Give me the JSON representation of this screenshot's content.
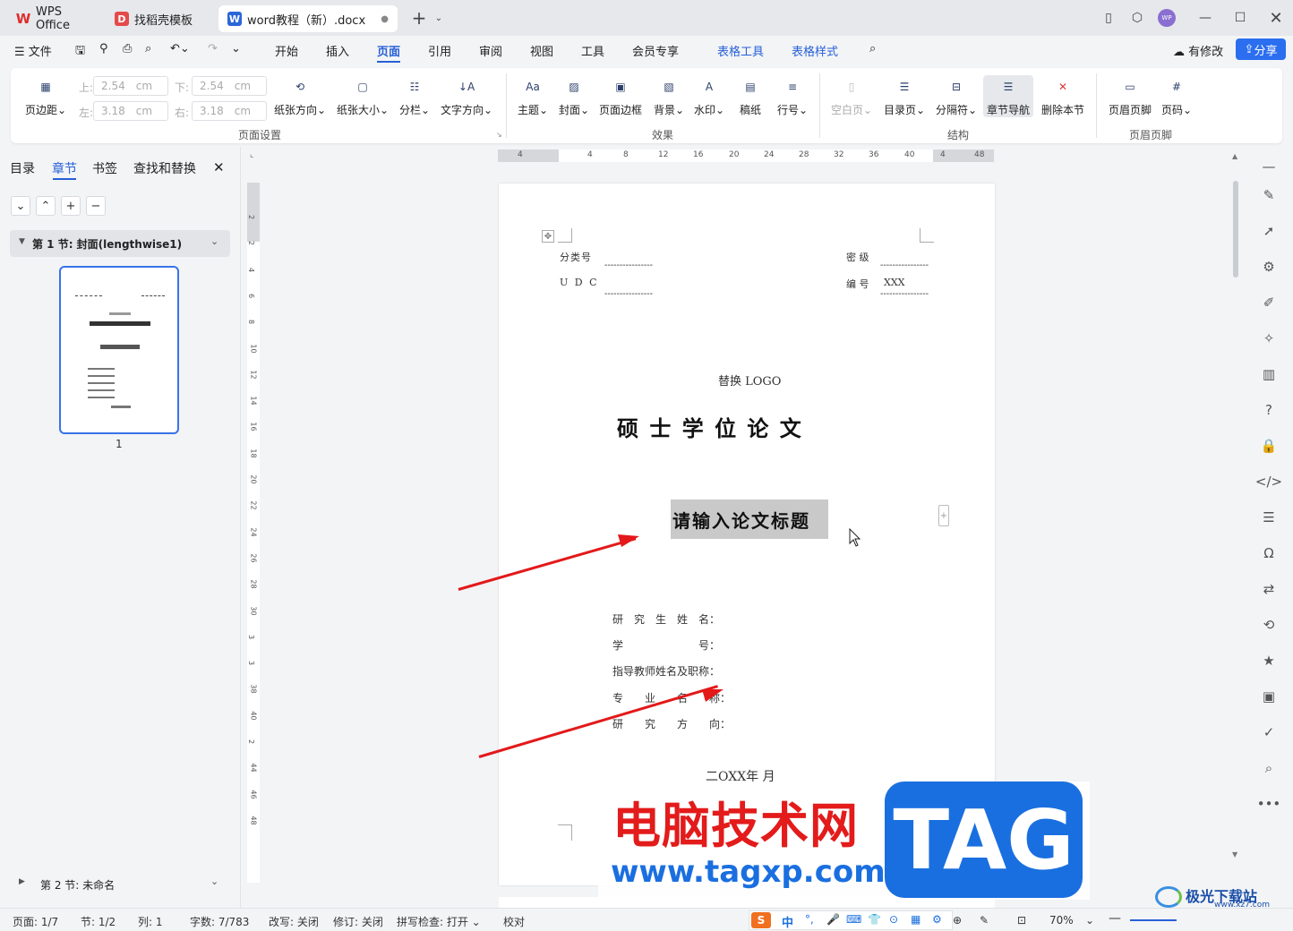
{
  "titlebar": {
    "tabs": [
      {
        "label": "WPS Office",
        "icon": "wps-logo-icon"
      },
      {
        "label": "找稻壳模板",
        "icon": "docer-icon"
      },
      {
        "label": "word教程（新）.docx",
        "icon": "word-doc-icon"
      }
    ],
    "avatar": "WP"
  },
  "menubar": {
    "file": "文件",
    "items": [
      "开始",
      "插入",
      "页面",
      "引用",
      "审阅",
      "视图",
      "工具",
      "会员专享",
      "表格工具",
      "表格样式"
    ],
    "active": "页面",
    "modified": "有修改",
    "share": "分享"
  },
  "ribbon": {
    "margins": {
      "top_label": "上:",
      "top": "2.54",
      "bottom_label": "下:",
      "bottom": "2.54",
      "left_label": "左:",
      "left": "3.18",
      "right_label": "右:",
      "right": "3.18",
      "unit": "cm"
    },
    "buttons": {
      "margin": "页边距",
      "orientation": "纸张方向",
      "size": "纸张大小",
      "columns": "分栏",
      "text_direction": "文字方向",
      "theme": "主题",
      "cover": "封面",
      "border": "页面边框",
      "background": "背景",
      "watermark": "水印",
      "manuscript": "稿纸",
      "line_number": "行号",
      "blank_page": "空白页",
      "toc_page": "目录页",
      "separator": "分隔符",
      "section_nav": "章节导航",
      "delete_section": "删除本节",
      "header_footer": "页眉页脚",
      "page_number": "页码"
    },
    "groups": [
      "页面设置",
      "效果",
      "结构",
      "页眉页脚"
    ]
  },
  "leftpanel": {
    "tabs": [
      "目录",
      "章节",
      "书签",
      "查找和替换"
    ],
    "active": "章节",
    "section1": "第 1 节: 封面(lengthwise1)",
    "thumb_page": "1",
    "section2": "第 2 节: 未命名"
  },
  "ruler": {
    "h": [
      "4",
      "4",
      "8",
      "12",
      "16",
      "20",
      "24",
      "28",
      "32",
      "36",
      "40",
      "4",
      "48"
    ],
    "v": [
      "2",
      "2",
      "4",
      "6",
      "8",
      "10",
      "12",
      "14",
      "16",
      "18",
      "20",
      "22",
      "24",
      "26",
      "28",
      "30",
      "3",
      "3",
      "38",
      "40",
      "2",
      "44",
      "46",
      "48"
    ]
  },
  "document": {
    "class_label": "分类号",
    "udc_label": "U D C",
    "secret_label": "密  级",
    "number_label": "编  号",
    "number_value": "XXX",
    "dashes": "----------------",
    "logo": "替换 LOGO",
    "degree": "硕  士  学  位  论  文",
    "title": "请输入论文标题",
    "fields": [
      "研　究　生　姓　名：",
      "学　　　　　　　号：",
      "指导教师姓名及职称：",
      "专　　业　　名　　称：",
      "研　　究　　方　　向："
    ],
    "date": "二OXX年   月"
  },
  "watermark": {
    "site_name": "电脑技术网",
    "url": "www.tagxp.com",
    "tag": "TAG",
    "corner": "极光下载站",
    "corner_url": "www.xz7.com"
  },
  "statusbar": {
    "page": "页面: 1/7",
    "section": "节: 1/2",
    "column": "列: 1",
    "words": "字数: 7/783",
    "rev": "改写: 关闭",
    "track": "修订: 关闭",
    "spell": "拼写检查: 打开",
    "proof": "校对",
    "zoom": "70%",
    "ime": "中"
  },
  "colors": {
    "accent": "#2660d6",
    "arrow": "#e3191a",
    "tag_blue": "#1a6fe0",
    "site_red": "#e31b1b"
  }
}
